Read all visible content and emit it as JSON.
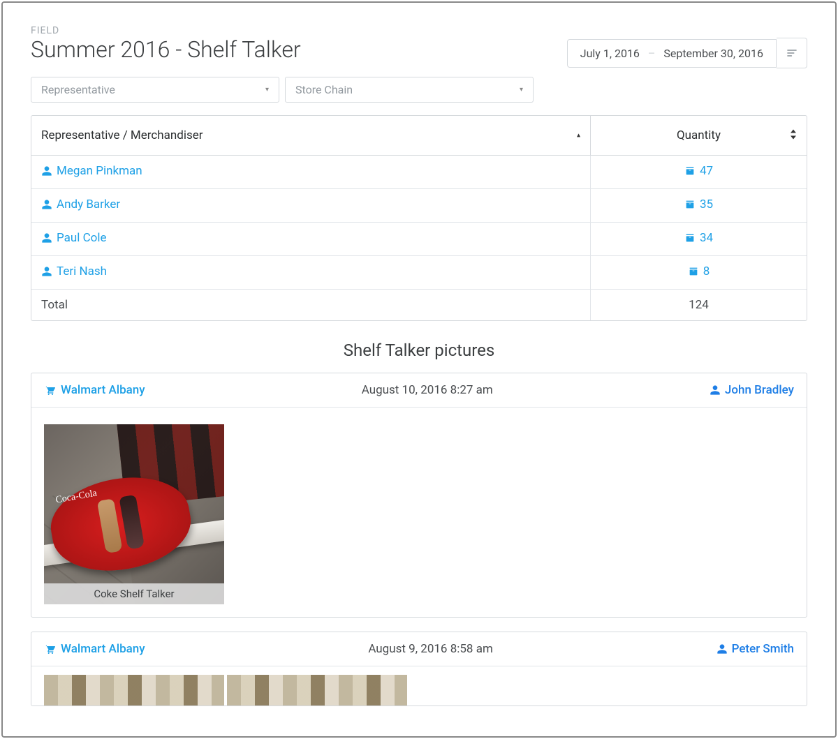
{
  "breadcrumb": "FIELD",
  "title": "Summer 2016 - Shelf Talker",
  "dateRange": {
    "start": "July 1, 2016",
    "end": "September 30, 2016"
  },
  "filters": {
    "representative": "Representative",
    "storeChain": "Store Chain"
  },
  "table": {
    "headers": {
      "rep": "Representative / Merchandiser",
      "qty": "Quantity"
    },
    "rows": [
      {
        "name": "Megan Pinkman",
        "qty": "47"
      },
      {
        "name": "Andy Barker",
        "qty": "35"
      },
      {
        "name": "Paul Cole",
        "qty": "34"
      },
      {
        "name": "Teri Nash",
        "qty": "8"
      }
    ],
    "totalLabel": "Total",
    "totalValue": "124"
  },
  "picturesSection": "Shelf Talker pictures",
  "cards": [
    {
      "store": "Walmart Albany",
      "timestamp": "August 10, 2016 8:27 am",
      "user": "John Bradley",
      "caption": "Coke Shelf Talker"
    },
    {
      "store": "Walmart Albany",
      "timestamp": "August 9, 2016 8:58 am",
      "user": "Peter Smith"
    }
  ]
}
